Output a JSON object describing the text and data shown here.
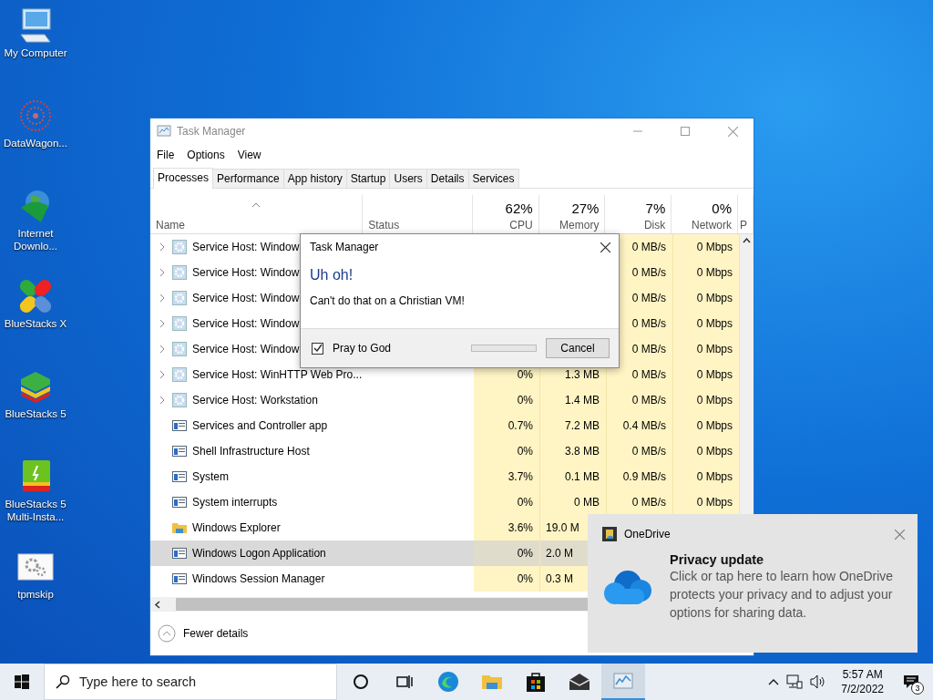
{
  "desktop_icons": [
    {
      "label": "My Computer",
      "kind": "monitor"
    },
    {
      "label": "DataWagon...",
      "kind": "pattern"
    },
    {
      "label": "Internet Downlo...",
      "kind": "globe"
    },
    {
      "label": "BlueStacks X",
      "kind": "bsx"
    },
    {
      "label": "BlueStacks 5",
      "kind": "bs5"
    },
    {
      "label": "BlueStacks 5 Multi-Insta...",
      "kind": "bsm"
    },
    {
      "label": "tpmskip",
      "kind": "gears"
    }
  ],
  "task_manager": {
    "title": "Task Manager",
    "menu": [
      "File",
      "Options",
      "View"
    ],
    "tabs": [
      {
        "label": "Processes",
        "selected": true
      },
      {
        "label": "Performance",
        "selected": false
      },
      {
        "label": "App history",
        "selected": false
      },
      {
        "label": "Startup",
        "selected": false
      },
      {
        "label": "Users",
        "selected": false
      },
      {
        "label": "Details",
        "selected": false
      },
      {
        "label": "Services",
        "selected": false
      }
    ],
    "columns": [
      {
        "label": "Name"
      },
      {
        "label": "Status"
      },
      {
        "percent": "62%",
        "label": "CPU"
      },
      {
        "percent": "27%",
        "label": "Memory"
      },
      {
        "percent": "7%",
        "label": "Disk"
      },
      {
        "percent": "0%",
        "label": "Network"
      },
      {
        "label": "P"
      }
    ],
    "rows": [
      {
        "name": "Service Host: Window",
        "kind": "gear",
        "expandable": true,
        "selected": false,
        "disk": "0 MB/s",
        "network": "0 Mbps"
      },
      {
        "name": "Service Host: Window",
        "kind": "gear",
        "expandable": true,
        "selected": false,
        "disk": "0 MB/s",
        "network": "0 Mbps"
      },
      {
        "name": "Service Host: Window",
        "kind": "gear",
        "expandable": true,
        "selected": false,
        "disk": "0 MB/s",
        "network": "0 Mbps"
      },
      {
        "name": "Service Host: Window",
        "kind": "gear",
        "expandable": true,
        "selected": false,
        "disk": "0 MB/s",
        "network": "0 Mbps"
      },
      {
        "name": "Service Host: Window",
        "kind": "gear",
        "expandable": true,
        "selected": false,
        "disk": "0 MB/s",
        "network": "0 Mbps"
      },
      {
        "name": "Service Host: WinHTTP Web Pro...",
        "kind": "gear",
        "expandable": true,
        "selected": false,
        "cpu": "0%",
        "memory": "1.3 MB",
        "disk": "0 MB/s",
        "network": "0 Mbps"
      },
      {
        "name": "Service Host: Workstation",
        "kind": "gear",
        "expandable": true,
        "selected": false,
        "cpu": "0%",
        "memory": "1.4 MB",
        "disk": "0 MB/s",
        "network": "0 Mbps"
      },
      {
        "name": "Services and Controller app",
        "kind": "app",
        "expandable": false,
        "selected": false,
        "cpu": "0.7%",
        "memory": "7.2 MB",
        "disk": "0.4 MB/s",
        "network": "0 Mbps"
      },
      {
        "name": "Shell Infrastructure Host",
        "kind": "app",
        "expandable": false,
        "selected": false,
        "cpu": "0%",
        "memory": "3.8 MB",
        "disk": "0 MB/s",
        "network": "0 Mbps"
      },
      {
        "name": "System",
        "kind": "app",
        "expandable": false,
        "selected": false,
        "cpu": "3.7%",
        "memory": "0.1 MB",
        "disk": "0.9 MB/s",
        "network": "0 Mbps"
      },
      {
        "name": "System interrupts",
        "kind": "app",
        "expandable": false,
        "selected": false,
        "cpu": "0%",
        "memory": "0 MB",
        "disk": "0 MB/s",
        "network": "0 Mbps"
      },
      {
        "name": "Windows Explorer",
        "kind": "folder",
        "expandable": false,
        "selected": false,
        "cpu": "3.6%",
        "memory": "19.0 M"
      },
      {
        "name": "Windows Logon Application",
        "kind": "app",
        "expandable": false,
        "selected": true,
        "cpu": "0%",
        "memory": "2.0 M"
      },
      {
        "name": "Windows Session Manager",
        "kind": "app",
        "expandable": false,
        "selected": false,
        "cpu": "0%",
        "memory": "0.3 M"
      }
    ],
    "footer": "Fewer details"
  },
  "dialog": {
    "title": "Task Manager",
    "heading": "Uh oh!",
    "message": "Can't do that on a Christian VM!",
    "checkbox": {
      "label": "Pray to God",
      "checked": true
    },
    "progress": {
      "level": 0
    },
    "button": "Cancel"
  },
  "toast": {
    "app": "OneDrive",
    "title": "Privacy update",
    "body": "Click or tap here to learn how OneDrive protects your privacy and to adjust your options for sharing data."
  },
  "taskbar": {
    "search": {
      "placeholder": "Type here to search"
    },
    "apps": [
      {
        "kind": "cortana",
        "selected": false
      },
      {
        "kind": "taskview",
        "selected": false
      },
      {
        "kind": "edge",
        "selected": false
      },
      {
        "kind": "explorer",
        "selected": false
      },
      {
        "kind": "store",
        "selected": false
      },
      {
        "kind": "mail",
        "selected": false
      },
      {
        "kind": "taskmgr",
        "selected": true
      }
    ],
    "time": "5:57 AM",
    "date": "7/2/2022",
    "notifications": "3"
  }
}
